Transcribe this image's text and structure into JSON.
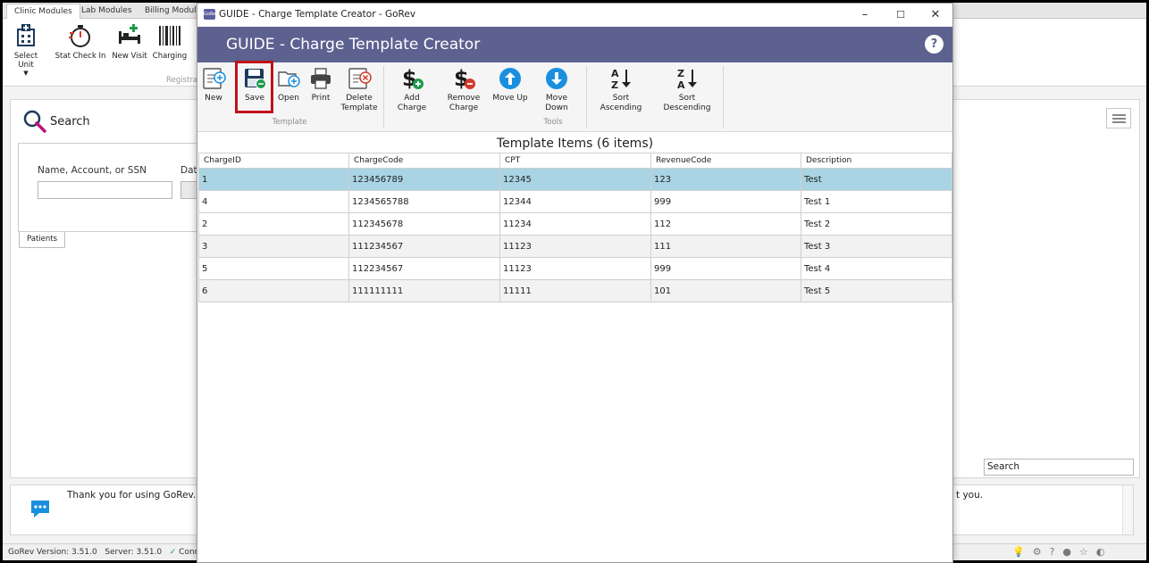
{
  "background": {
    "tabs": [
      "Clinic Modules",
      "Lab Modules",
      "Billing Modules"
    ],
    "ribbon_buttons": [
      "Select Unit",
      "Stat Check In",
      "New Visit",
      "Charging"
    ],
    "ribbon_group": "Registra",
    "search_title": "Search",
    "search_field_label": "Name, Account, or SSN",
    "date_label": "Date",
    "patients_tab": "Patients",
    "right_search_placeholder": "Search",
    "message_start": "Thank you for using GoRev.  It",
    "message_end": "t you.",
    "status": {
      "version": "GoRev Version: 3.51.0",
      "server": "Server: 3.51.0",
      "connection": "Conn"
    }
  },
  "dialog": {
    "window_title": "GUIDE - Charge Template Creator - GoRev",
    "app_icon_text": "GoRev",
    "header_title": "GUIDE - Charge Template Creator",
    "help_label": "?",
    "controls": {
      "minimize": "–",
      "maximize": "☐",
      "close": "✕"
    },
    "toolbar": {
      "template_group": "Template",
      "tools_group": "Tools",
      "new": "New",
      "save": "Save",
      "open": "Open",
      "print": "Print",
      "delete_template_1": "Delete",
      "delete_template_2": "Template",
      "add_charge": "Add Charge",
      "remove_charge_1": "Remove",
      "remove_charge_2": "Charge",
      "move_up": "Move Up",
      "move_down": "Move Down",
      "sort_ascending": "Sort Ascending",
      "sort_descending": "Sort Descending"
    },
    "grid_title": "Template Items (6 items)",
    "columns": [
      "ChargeID",
      "ChargeCode",
      "CPT",
      "RevenueCode",
      "Description"
    ],
    "rows": [
      [
        "1",
        "123456789",
        "12345",
        "123",
        "Test"
      ],
      [
        "4",
        "1234565788",
        "12344",
        "999",
        "Test 1"
      ],
      [
        "2",
        "112345678",
        "11234",
        "112",
        "Test 2"
      ],
      [
        "3",
        "111234567",
        "11123",
        "111",
        "Test 3"
      ],
      [
        "5",
        "112234567",
        "11123",
        "999",
        "Test 4"
      ],
      [
        "6",
        "111111111",
        "11111",
        "101",
        "Test 5"
      ]
    ],
    "selected_row": 0
  },
  "colors": {
    "header_band": "#5d6190",
    "highlight": "#c0111a",
    "selected_row": "#a9d4e3",
    "accent_blue": "#1a8fe0",
    "add_green": "#1f9a4b",
    "remove_red": "#d23a2b"
  }
}
